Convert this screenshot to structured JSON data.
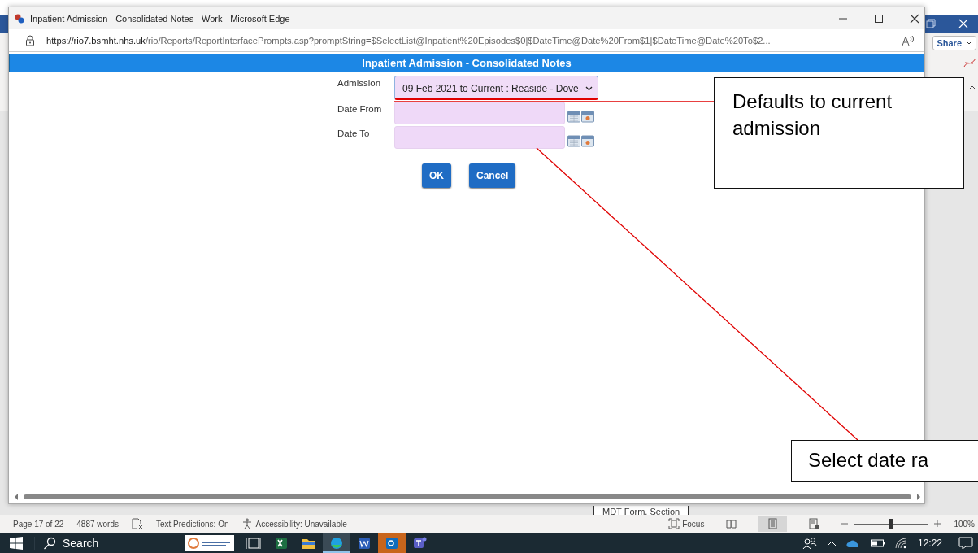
{
  "browser": {
    "title": "Inpatient Admission - Consolidated Notes - Work - Microsoft Edge",
    "url_host": "https://rio7.bsmht.nhs.uk",
    "url_path": "/rio/Reports/ReportInterfacePrompts.asp?promptString=$SelectList@Inpatient%20Episodes$0|$DateTime@Date%20From$1|$DateTime@Date%20To$2..."
  },
  "page": {
    "header": "Inpatient Admission - Consolidated Notes",
    "fields": [
      {
        "kind": "select",
        "label": "Admission",
        "value": "09 Feb 2021 to Current : Reaside - Dove"
      },
      {
        "kind": "date",
        "label": "Date From"
      },
      {
        "kind": "date",
        "label": "Date To"
      }
    ],
    "buttons": [
      "OK",
      "Cancel"
    ]
  },
  "callouts": [
    {
      "text": "Defaults to current admission"
    },
    {
      "text": "Select date ra"
    }
  ],
  "word": {
    "share": "Share",
    "document_text": "MDT Form, Section",
    "status_bar": {
      "page": "Page 17 of 22",
      "words": "4887 words",
      "text_predictions": "Text Predictions: On",
      "accessibility": "Accessibility: Unavailable",
      "focus": "Focus",
      "views": [
        {
          "kind": "read",
          "selected": false
        },
        {
          "kind": "print",
          "selected": true
        },
        {
          "kind": "web",
          "selected": false
        }
      ],
      "zoom": {
        "level": 0.5,
        "reading": "100%"
      }
    }
  },
  "taskbar": {
    "search": "Search",
    "apps": [
      {
        "kind": "thumbnail",
        "selected": false
      },
      {
        "kind": "taskview",
        "selected": false
      },
      {
        "kind": "excel",
        "selected": false
      },
      {
        "kind": "folder",
        "selected": false
      },
      {
        "kind": "edge",
        "selected": true
      },
      {
        "kind": "word",
        "selected": false
      },
      {
        "kind": "outlook",
        "selected": false,
        "flashing": true
      },
      {
        "kind": "teams",
        "selected": false
      }
    ],
    "clock": "12:22"
  }
}
